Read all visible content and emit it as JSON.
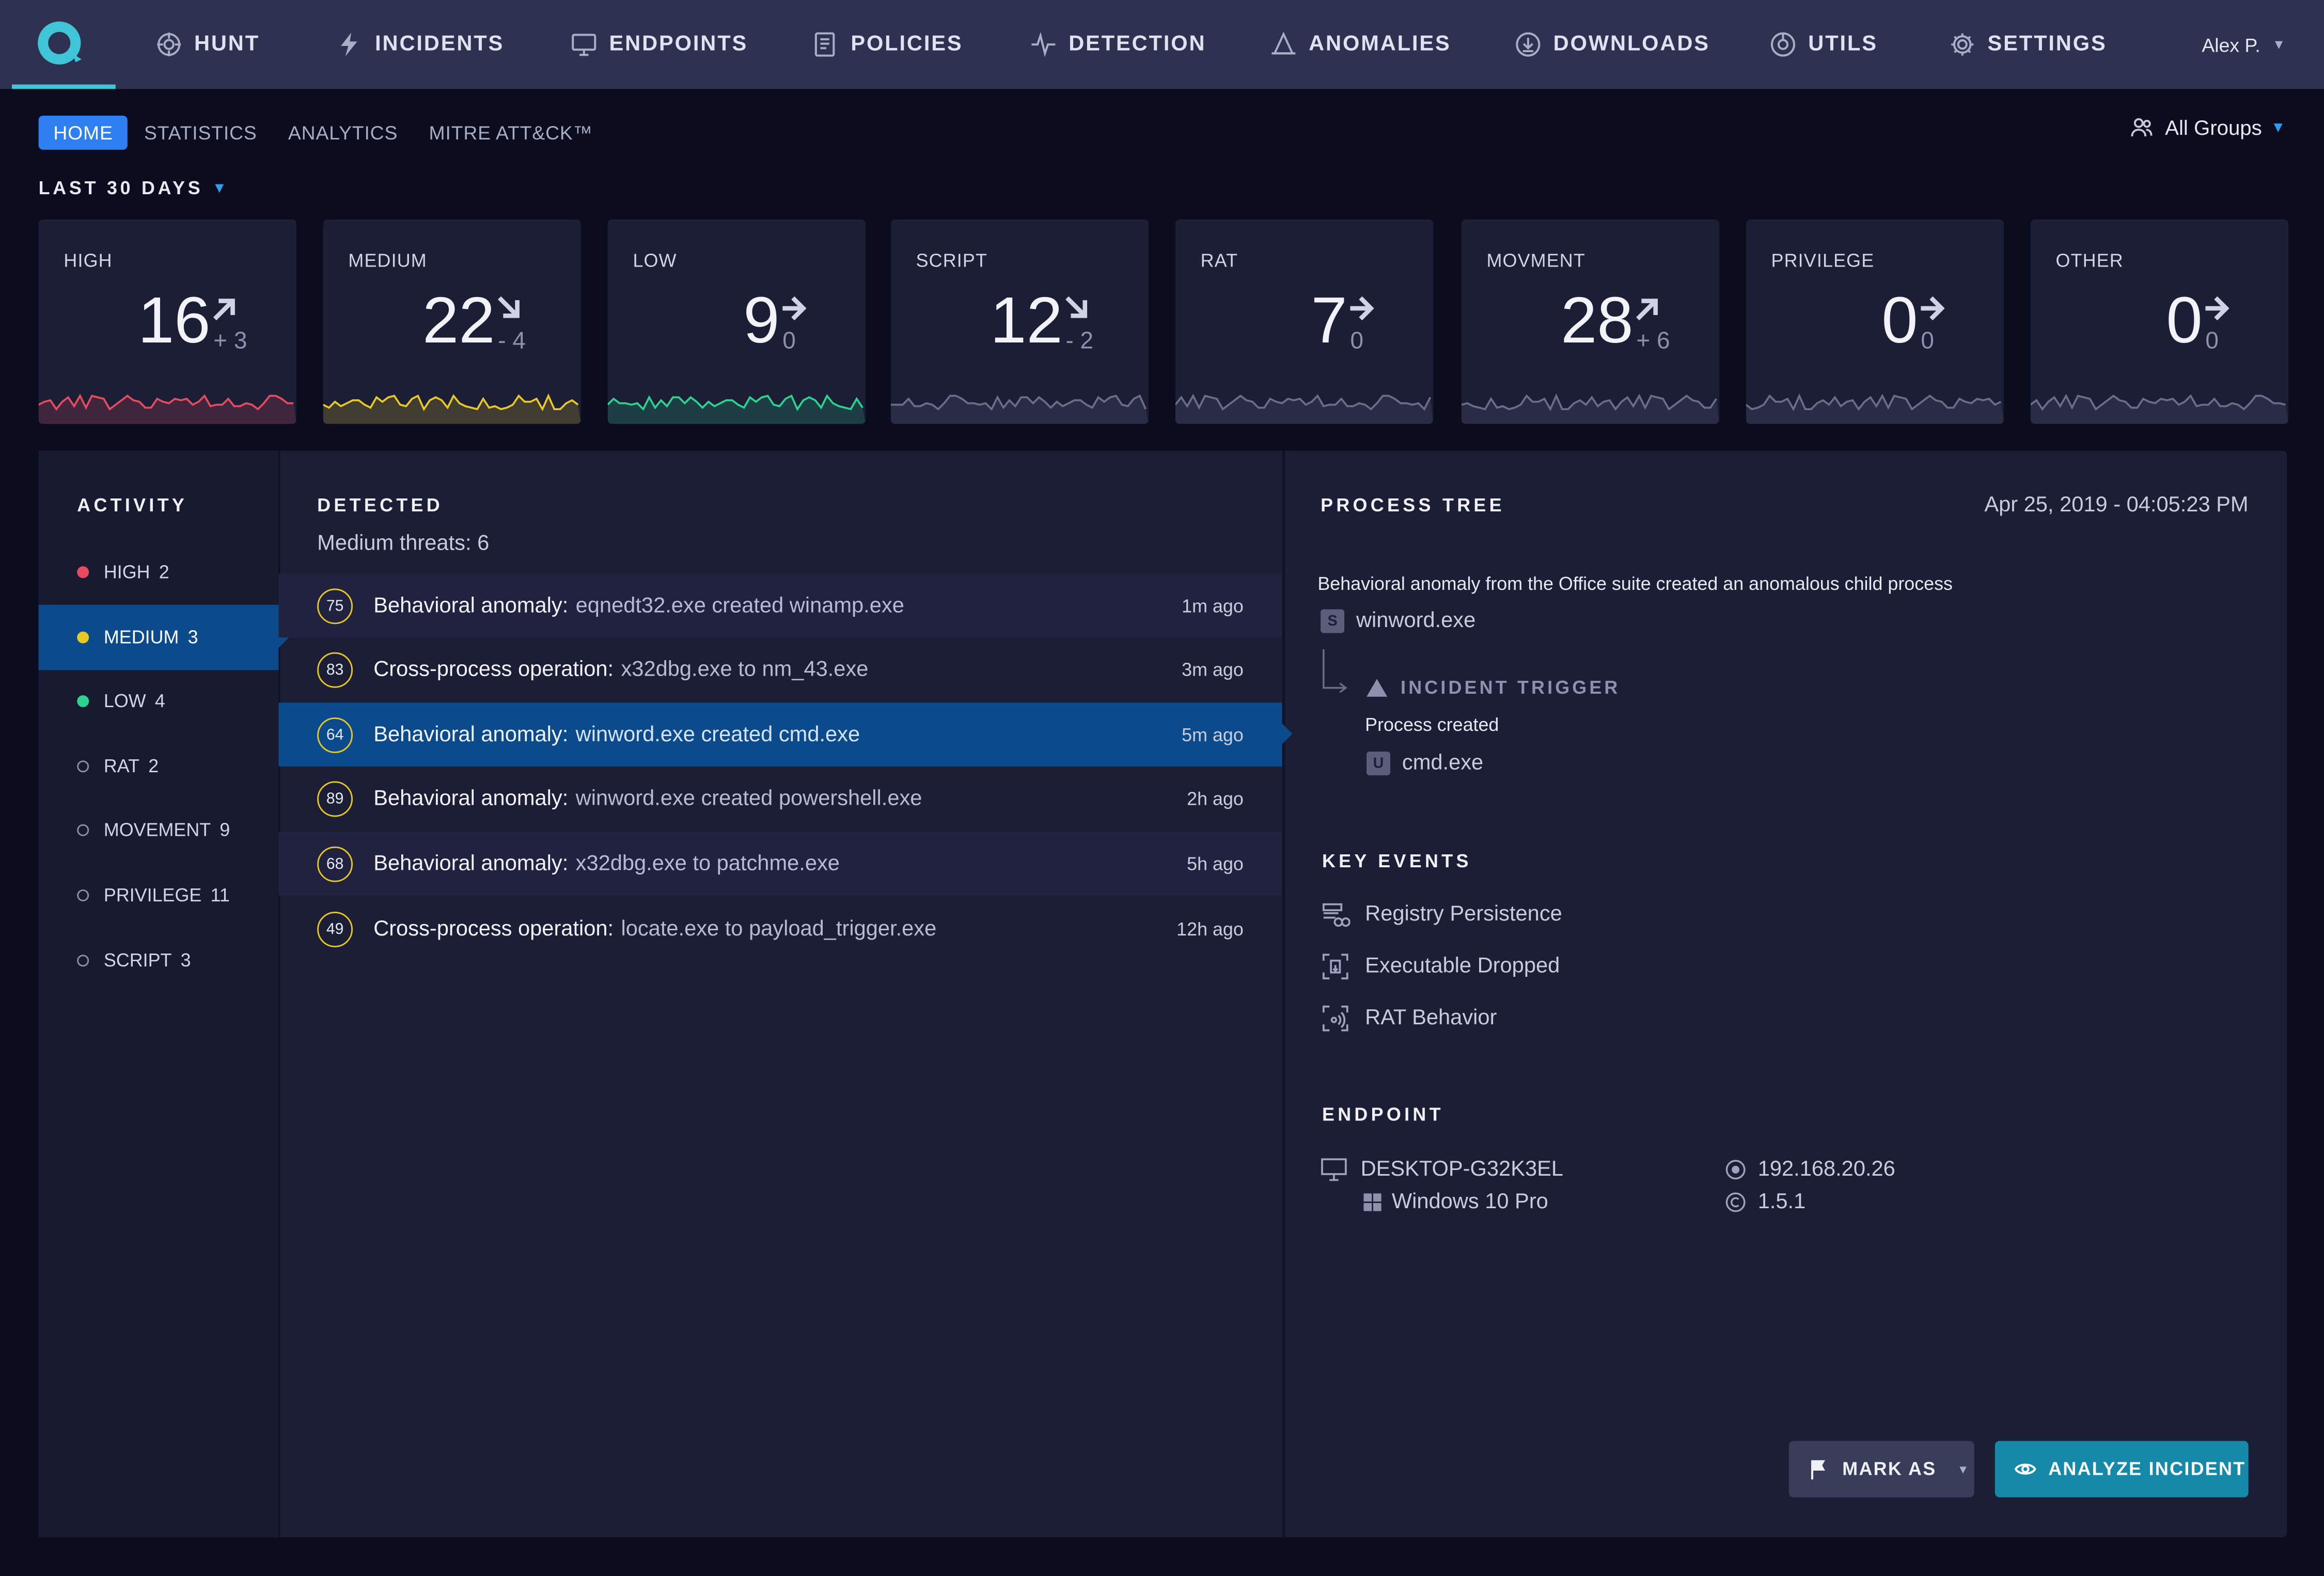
{
  "app": {
    "brand_color": "#3fc4d8",
    "accent_color": "#2e7ff0"
  },
  "nav": {
    "items": [
      {
        "label": "HUNT",
        "icon": "crosshair-icon"
      },
      {
        "label": "INCIDENTS",
        "icon": "lightning-icon"
      },
      {
        "label": "ENDPOINTS",
        "icon": "monitor-icon"
      },
      {
        "label": "POLICIES",
        "icon": "document-icon"
      },
      {
        "label": "DETECTION",
        "icon": "pulse-icon"
      },
      {
        "label": "ANOMALIES",
        "icon": "bell-icon"
      },
      {
        "label": "DOWNLOADS",
        "icon": "download-icon"
      },
      {
        "label": "UTILS",
        "icon": "tools-icon"
      },
      {
        "label": "SETTINGS",
        "icon": "gear-icon"
      }
    ],
    "user": "Alex P."
  },
  "subnav": {
    "tabs": [
      "HOME",
      "STATISTICS",
      "ANALYTICS",
      "MITRE ATT&CK™"
    ],
    "active": "HOME",
    "groups_label": "All Groups",
    "period_label": "LAST 30 DAYS"
  },
  "stats": [
    {
      "label": "HIGH",
      "value": "16",
      "delta": "+ 3",
      "trend": "up",
      "color": "#e64b5f"
    },
    {
      "label": "MEDIUM",
      "value": "22",
      "delta": "- 4",
      "trend": "down",
      "color": "#e8c826"
    },
    {
      "label": "LOW",
      "value": "9",
      "delta": "0",
      "trend": "flat",
      "color": "#2ed28f"
    },
    {
      "label": "SCRIPT",
      "value": "12",
      "delta": "- 2",
      "trend": "down",
      "color": "#6a6e88"
    },
    {
      "label": "RAT",
      "value": "7",
      "delta": "0",
      "trend": "flat",
      "color": "#6a6e88"
    },
    {
      "label": "MOVMENT",
      "value": "28",
      "delta": "+ 6",
      "trend": "up",
      "color": "#6a6e88"
    },
    {
      "label": "PRIVILEGE",
      "value": "0",
      "delta": "0",
      "trend": "flat",
      "color": "#6a6e88"
    },
    {
      "label": "OTHER",
      "value": "0",
      "delta": "0",
      "trend": "flat",
      "color": "#6a6e88"
    }
  ],
  "activity": {
    "title": "ACTIVITY",
    "items": [
      {
        "label": "HIGH",
        "count": "2",
        "color": "#e64b5f",
        "filled": true
      },
      {
        "label": "MEDIUM",
        "count": "3",
        "color": "#e8c826",
        "filled": true
      },
      {
        "label": "LOW",
        "count": "4",
        "color": "#2ed28f",
        "filled": true
      },
      {
        "label": "RAT",
        "count": "2",
        "color": "#8d91ae",
        "filled": false
      },
      {
        "label": "MOVEMENT",
        "count": "9",
        "color": "#8d91ae",
        "filled": false
      },
      {
        "label": "PRIVILEGE",
        "count": "11",
        "color": "#8d91ae",
        "filled": false
      },
      {
        "label": "SCRIPT",
        "count": "3",
        "color": "#8d91ae",
        "filled": false
      }
    ],
    "selected": "MEDIUM"
  },
  "detected": {
    "title": "DETECTED",
    "subtitle": "Medium threats: 6",
    "rows": [
      {
        "score": "75",
        "kind": "Behavioral anomaly:",
        "detail": "eqnedt32.exe created winamp.exe",
        "time": "1m  ago"
      },
      {
        "score": "83",
        "kind": "Cross-process operation:",
        "detail": "x32dbg.exe to nm_43.exe",
        "time": "3m  ago"
      },
      {
        "score": "64",
        "kind": "Behavioral anomaly:",
        "detail": "winword.exe created cmd.exe",
        "time": "5m ago"
      },
      {
        "score": "89",
        "kind": "Behavioral anomaly:",
        "detail": "winword.exe created powershell.exe",
        "time": "2h ago"
      },
      {
        "score": "68",
        "kind": "Behavioral anomaly:",
        "detail": "x32dbg.exe to patchme.exe",
        "time": "5h  ago"
      },
      {
        "score": "49",
        "kind": "Cross-process operation:",
        "detail": "locate.exe to payload_trigger.exe",
        "time": "12h ago"
      }
    ],
    "selected_index": 2
  },
  "process_tree": {
    "title": "PROCESS TREE",
    "timestamp": "Apr 25, 2019 - 04:05:23 PM",
    "description": "Behavioral anomaly from the Office suite created an anomalous child process",
    "parent": {
      "badge": "S",
      "name": "winword.exe"
    },
    "trigger_label": "INCIDENT TRIGGER",
    "trigger_text": "Process created",
    "child": {
      "badge": "U",
      "name": "cmd.exe"
    }
  },
  "key_events": {
    "title": "KEY EVENTS",
    "items": [
      {
        "label": "Registry Persistence",
        "icon": "registry-icon"
      },
      {
        "label": "Executable Dropped",
        "icon": "file-drop-icon"
      },
      {
        "label": "RAT Behavior",
        "icon": "remote-access-icon"
      }
    ]
  },
  "endpoint": {
    "title": "ENDPOINT",
    "hostname": "DESKTOP-G32K3EL",
    "os": "Windows 10 Pro",
    "ip": "192.168.20.26",
    "version": "1.5.1"
  },
  "actions": {
    "mark_as": "MARK AS",
    "analyze": "ANALYZE INCIDENT"
  }
}
